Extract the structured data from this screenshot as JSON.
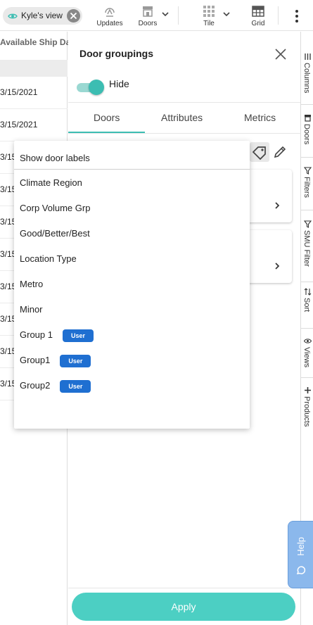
{
  "toolbar": {
    "view_label": "Kyle's view",
    "buttons": [
      {
        "label": "Updates"
      },
      {
        "label": "Doors"
      },
      {
        "label": "Tile"
      },
      {
        "label": "Grid"
      }
    ]
  },
  "table": {
    "header": "Available Ship Da",
    "rows": [
      "3/15/2021",
      "3/15/2021",
      "3/15",
      "3/15",
      "3/15",
      "3/15",
      "3/15",
      "3/15",
      "3/15",
      "3/15"
    ]
  },
  "panel": {
    "title": "Door groupings",
    "toggle_label": "Hide",
    "toggle_on": true,
    "tabs": [
      "Doors",
      "Attributes",
      "Metrics"
    ],
    "active_tab": "Doors",
    "apply_label": "Apply"
  },
  "dropdown": {
    "header": "Show door labels",
    "items": [
      {
        "label": "Climate Region",
        "badge": ""
      },
      {
        "label": "Corp Volume Grp",
        "badge": ""
      },
      {
        "label": "Good/Better/Best",
        "badge": ""
      },
      {
        "label": "Location Type",
        "badge": ""
      },
      {
        "label": "Metro",
        "badge": ""
      },
      {
        "label": "Minor",
        "badge": ""
      },
      {
        "label": "Group 1",
        "badge": "User"
      },
      {
        "label": "Group1",
        "badge": "User"
      },
      {
        "label": "Group2",
        "badge": "User"
      }
    ]
  },
  "sidebar": {
    "items": [
      {
        "label": "Columns",
        "icon": "columns-icon"
      },
      {
        "label": "Doors",
        "icon": "store-icon"
      },
      {
        "label": "Filters",
        "icon": "filter-icon"
      },
      {
        "label": "SMU Filter",
        "icon": "filter-icon"
      },
      {
        "label": "Sort",
        "icon": "sort-icon"
      },
      {
        "label": "Views",
        "icon": "eye-icon"
      },
      {
        "label": "Products",
        "icon": "plus-icon"
      }
    ]
  },
  "help": {
    "label": "Help"
  },
  "colors": {
    "accent": "#3cbdb2",
    "apply": "#4ccfc3",
    "badge": "#1f6fd1",
    "help": "#8bb8ec"
  }
}
